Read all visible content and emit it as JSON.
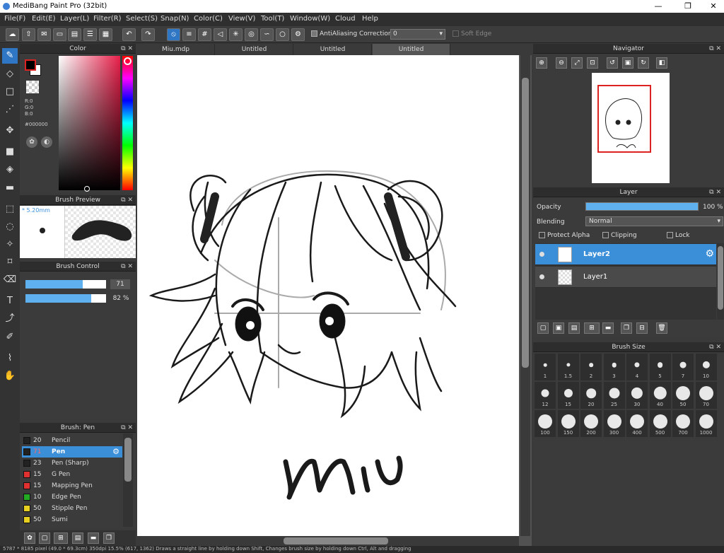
{
  "window": {
    "title": "MediBang Paint Pro (32bit)",
    "minimize": "—",
    "restore": "❐",
    "close": "✕"
  },
  "menu": [
    "File(F)",
    "Edit(E)",
    "Layer(L)",
    "Filter(R)",
    "Select(S)",
    "Snap(N)",
    "Color(C)",
    "View(V)",
    "Tool(T)",
    "Window(W)",
    "Cloud",
    "Help"
  ],
  "toolbar": {
    "antialiasing_label": "AntiAliasing",
    "correction_label": "Correction",
    "correction_value": "0",
    "soft_edge_label": "Soft Edge"
  },
  "tabs": [
    "Miu.mdp",
    "Untitled",
    "Untitled",
    "Untitled"
  ],
  "color_panel": {
    "title": "Color",
    "r": "R:0",
    "g": "G:0",
    "b": "B:0",
    "hex": "#000000",
    "fg": "#000000",
    "bg": "#ffffff"
  },
  "brush_preview": {
    "title": "Brush Preview",
    "size": "* 5.20mm"
  },
  "brush_control": {
    "title": "Brush Control",
    "size_value": "71",
    "opacity_value": "82 %",
    "size_fraction": 0.71,
    "opacity_fraction": 0.82
  },
  "brush_list": {
    "title": "Brush: Pen",
    "items": [
      {
        "size": "20",
        "name": "Pencil",
        "color": "#222222"
      },
      {
        "size": "71",
        "name": "Pen",
        "color": "#222222"
      },
      {
        "size": "23",
        "name": "Pen (Sharp)",
        "color": "#222222"
      },
      {
        "size": "15",
        "name": "G Pen",
        "color": "#e03030"
      },
      {
        "size": "15",
        "name": "Mapping Pen",
        "color": "#e03030"
      },
      {
        "size": "10",
        "name": "Edge Pen",
        "color": "#22aa22"
      },
      {
        "size": "50",
        "name": "Stipple Pen",
        "color": "#e8d020"
      },
      {
        "size": "50",
        "name": "Sumi",
        "color": "#e8d020"
      }
    ]
  },
  "navigator": {
    "title": "Navigator"
  },
  "layer_panel": {
    "title": "Layer",
    "opacity_label": "Opacity",
    "opacity_value": "100 %",
    "blending_label": "Blending",
    "blending_value": "Normal",
    "protect_alpha": "Protect Alpha",
    "clipping": "Clipping",
    "lock": "Lock",
    "layers": [
      "Layer2",
      "Layer1"
    ]
  },
  "brush_size": {
    "title": "Brush Size",
    "sizes": [
      "1",
      "1.5",
      "2",
      "3",
      "4",
      "5",
      "7",
      "10",
      "12",
      "15",
      "20",
      "25",
      "30",
      "40",
      "50",
      "70",
      "100",
      "150",
      "200",
      "300",
      "400",
      "500",
      "700",
      "1000"
    ]
  },
  "status": "5787 * 8185 pixel (49.0 * 69.3cm) 350dpi 15.5% (617, 1362) Draws a straight line by holding down Shift, Changes brush size by holding down Ctrl, Alt and dragging"
}
